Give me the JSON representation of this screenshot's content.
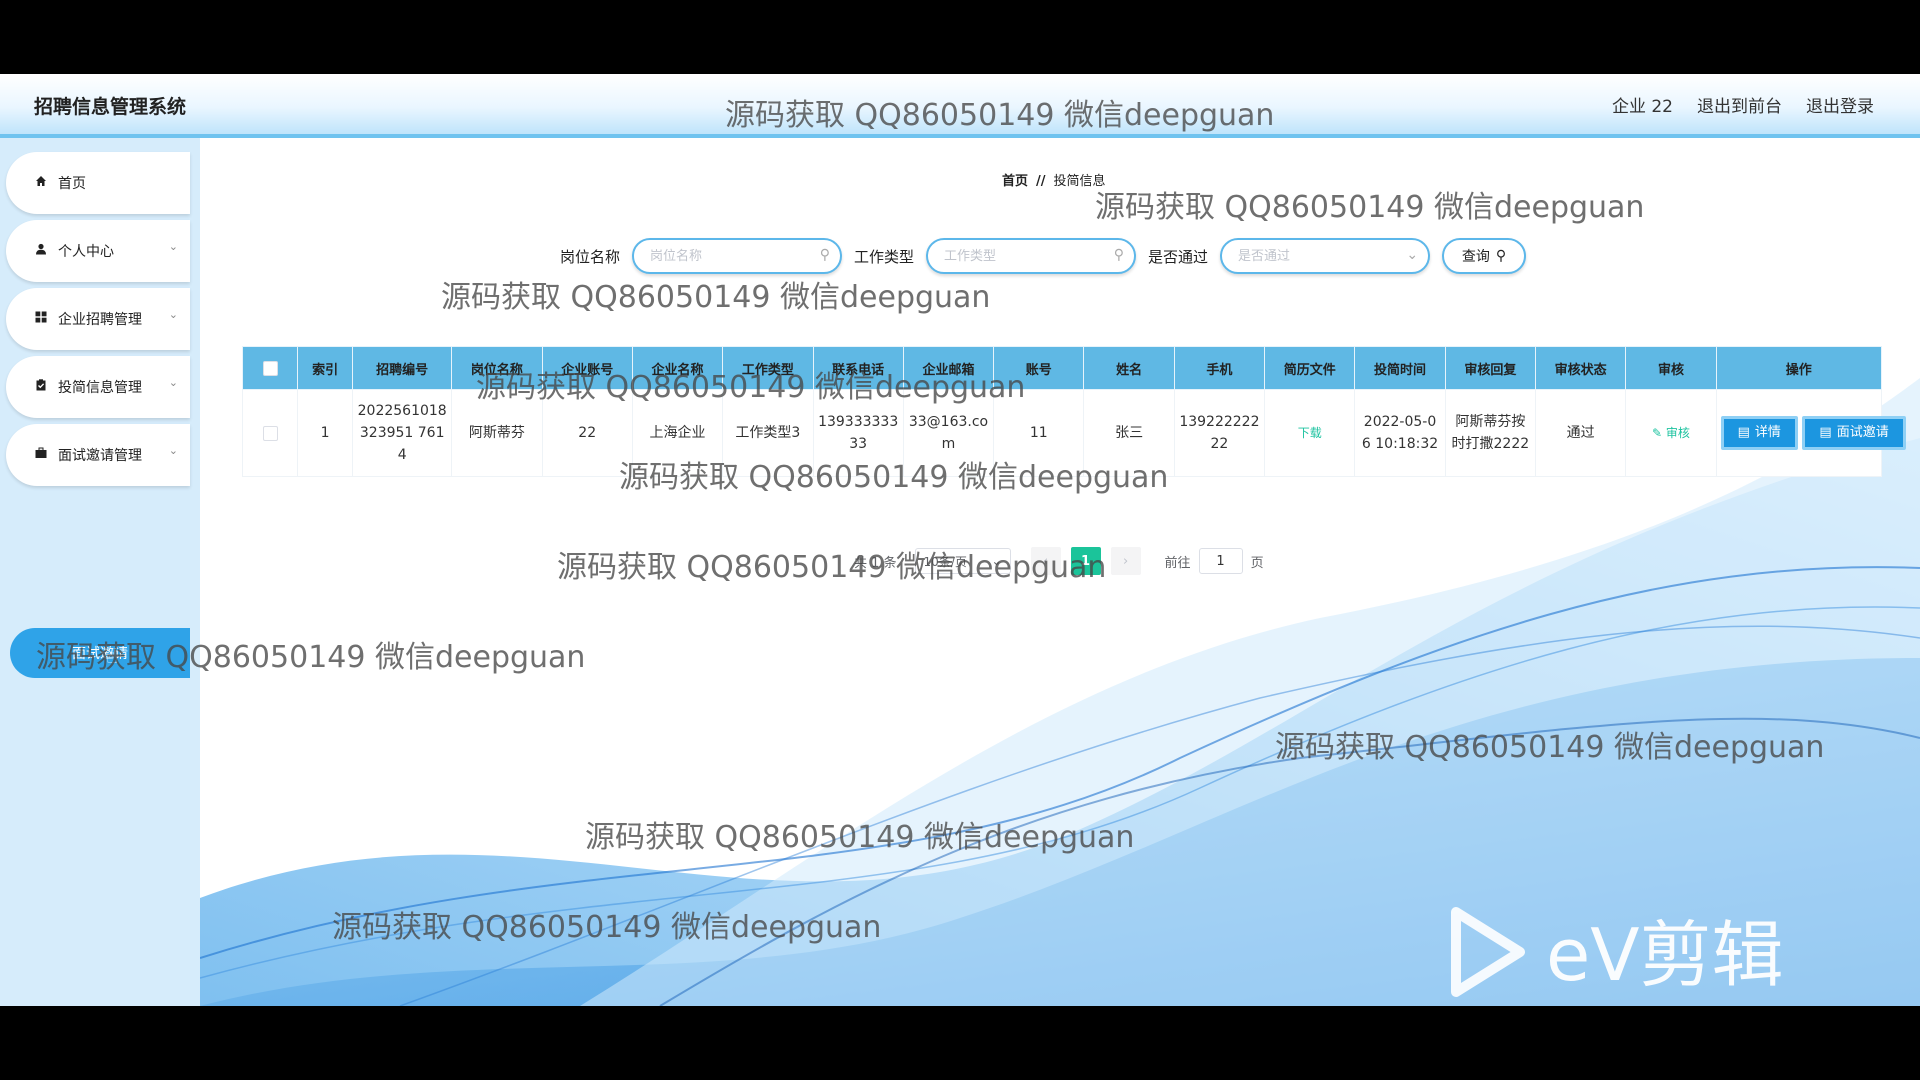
{
  "header": {
    "title": "招聘信息管理系统",
    "user": "企业 22",
    "to_front": "退出到前台",
    "logout": "退出登录"
  },
  "sidebar": {
    "items": [
      {
        "label": "首页",
        "icon": "home-icon",
        "has_submenu": false
      },
      {
        "label": "个人中心",
        "icon": "user-icon",
        "has_submenu": true
      },
      {
        "label": "企业招聘管理",
        "icon": "grid-icon",
        "has_submenu": true
      },
      {
        "label": "投简信息管理",
        "icon": "clipboard-icon",
        "has_submenu": true
      },
      {
        "label": "面试邀请管理",
        "icon": "briefcase-icon",
        "has_submenu": true
      }
    ],
    "active_submenu": "面试邀请"
  },
  "breadcrumb": {
    "home": "首页",
    "separator": "//",
    "current": "投简信息"
  },
  "search": {
    "fields": [
      {
        "label": "岗位名称",
        "placeholder": "岗位名称",
        "type": "text"
      },
      {
        "label": "工作类型",
        "placeholder": "工作类型",
        "type": "text"
      },
      {
        "label": "是否通过",
        "placeholder": "是否通过",
        "type": "select"
      }
    ],
    "button": "查询"
  },
  "table": {
    "columns": [
      "索引",
      "招聘编号",
      "岗位名称",
      "企业账号",
      "企业名称",
      "工作类型",
      "联系电话",
      "企业邮箱",
      "账号",
      "姓名",
      "手机",
      "简历文件",
      "投简时间",
      "审核回复",
      "审核状态",
      "审核",
      "操作"
    ],
    "rows": [
      {
        "index": "1",
        "recruit_no": "2022561018323951 7614",
        "job_name": "阿斯蒂芬",
        "company_account": "22",
        "company_name": "上海企业",
        "job_type": "工作类型3",
        "phone": "13933333333",
        "email": "33@163.com",
        "account": "11",
        "name": "张三",
        "mobile": "13922222222",
        "resume": "下载",
        "submit_time": "2022-05-06 10:18:32",
        "audit_reply": "阿斯蒂芬按时打撒2222",
        "audit_status": "通过",
        "audit": "审核",
        "ops": [
          "详情",
          "面试邀请"
        ]
      }
    ]
  },
  "pagination": {
    "total": "共 1 条",
    "page_size": "10条/页",
    "current_page": "1",
    "goto_label": "前往",
    "goto_value": "1",
    "goto_suffix": "页"
  },
  "watermark": "源码获取 QQ86050149 微信deepguan",
  "ev_logo": {
    "text": "eV剪辑"
  },
  "colors": {
    "header_bottom": "#6fc3ef",
    "sidebar_bg": "#d6ecfb",
    "active_submenu": "#2fa3e8",
    "table_header": "#5fb8e4",
    "op_button": "#1c96e0",
    "link_green": "#1ec3a0",
    "page_active": "#1bc49a"
  }
}
